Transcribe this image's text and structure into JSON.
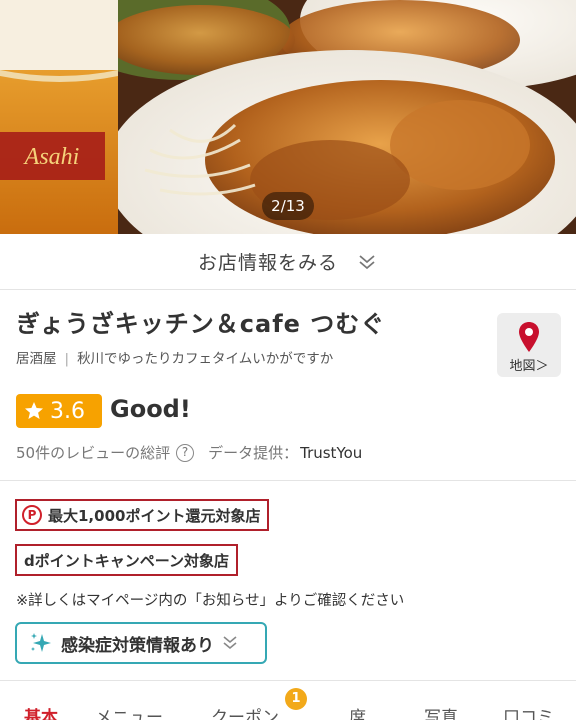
{
  "hero": {
    "photo_counter": "2/13"
  },
  "info_bar": {
    "label": "お店情報をみる",
    "icon": "chevron-double-down-icon"
  },
  "shop": {
    "name": "ぎょうざキッチン＆cafe つむぐ",
    "genre": "居酒屋",
    "catchphrase": "秋川でゆったりカフェタイムいかがですか",
    "map_label": "地図＞",
    "map_icon": "map-pin-icon",
    "pin_color": "#c8102e"
  },
  "rating": {
    "score": "3.6",
    "word": "Good!",
    "review_summary": "50件のレビューの総評",
    "help_icon": "question-circle-icon",
    "provider_prefix": "データ提供：",
    "provider": "TrustYou",
    "badge_color": "#f7a200"
  },
  "points": {
    "point_box_label": "最大1,000ポイント還元対象店",
    "point_icon_text": "P",
    "campaign_label": "dポイントキャンペーン対象店",
    "note": "※詳しくはマイページ内の「お知らせ」よりご確認ください",
    "accent_color": "#b0202b"
  },
  "covid": {
    "label": "感染症対策情報あり",
    "icon": "sparkle-icon",
    "border_color": "#35a8b4"
  },
  "tabs": [
    {
      "label": "基本",
      "active": true
    },
    {
      "label": "メニュー"
    },
    {
      "label": "クーポン",
      "badge": "1"
    },
    {
      "label": "席"
    },
    {
      "label": "写真"
    },
    {
      "label": "口コミ"
    }
  ]
}
